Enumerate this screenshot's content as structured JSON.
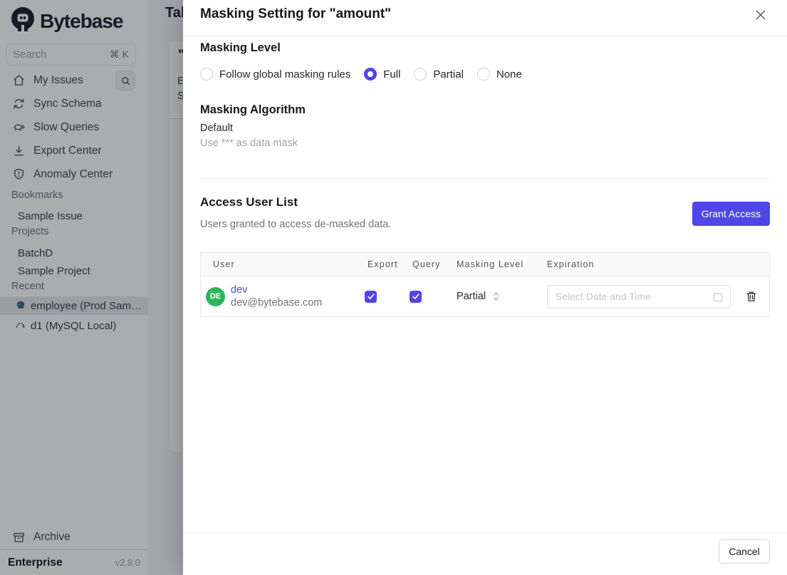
{
  "colors": {
    "accent": "#4f46e5",
    "avatar_green": "#2db55d"
  },
  "sidebar": {
    "logo_text": "Bytebase",
    "search_placeholder": "Search",
    "search_shortcut": "⌘ K",
    "nav": [
      {
        "label": "My Issues"
      },
      {
        "label": "Sync Schema"
      },
      {
        "label": "Slow Queries"
      },
      {
        "label": "Export Center"
      },
      {
        "label": "Anomaly Center"
      }
    ],
    "bookmarks_label": "Bookmarks",
    "bookmarks": [
      {
        "label": "Sample Issue"
      }
    ],
    "projects_label": "Projects",
    "projects": [
      {
        "label": "BatchD"
      },
      {
        "label": "Sample Project"
      }
    ],
    "recent_label": "Recent",
    "recent": [
      {
        "label": "employee (Prod Sam…"
      },
      {
        "label": "d1 (MySQL Local)"
      }
    ],
    "archive_label": "Archive",
    "plan": "Enterprise",
    "version": "v2.9.0"
  },
  "background_page": {
    "title_fragment": "Tab",
    "heading_fragment": "\"",
    "line1_fragment": "E",
    "line2_fragment": "S"
  },
  "modal": {
    "title": "Masking Setting for \"amount\"",
    "masking_level_heading": "Masking Level",
    "radio_options": [
      {
        "label": "Follow global masking rules",
        "selected": false
      },
      {
        "label": "Full",
        "selected": true
      },
      {
        "label": "Partial",
        "selected": false
      },
      {
        "label": "None",
        "selected": false
      }
    ],
    "masking_algorithm_heading": "Masking Algorithm",
    "algorithm_name": "Default",
    "algorithm_description": "Use *** as data mask",
    "access_heading": "Access User List",
    "access_subtitle": "Users granted to access de-masked data.",
    "grant_access_label": "Grant Access",
    "table": {
      "columns": [
        "User",
        "Export",
        "Query",
        "Masking Level",
        "Expiration"
      ],
      "row": {
        "avatar_initials": "DE",
        "name": "dev",
        "email": "dev@bytebase.com",
        "export_checked": true,
        "query_checked": true,
        "masking_level": "Partial",
        "expiration_placeholder": "Select Date and Time"
      }
    },
    "cancel_label": "Cancel"
  }
}
